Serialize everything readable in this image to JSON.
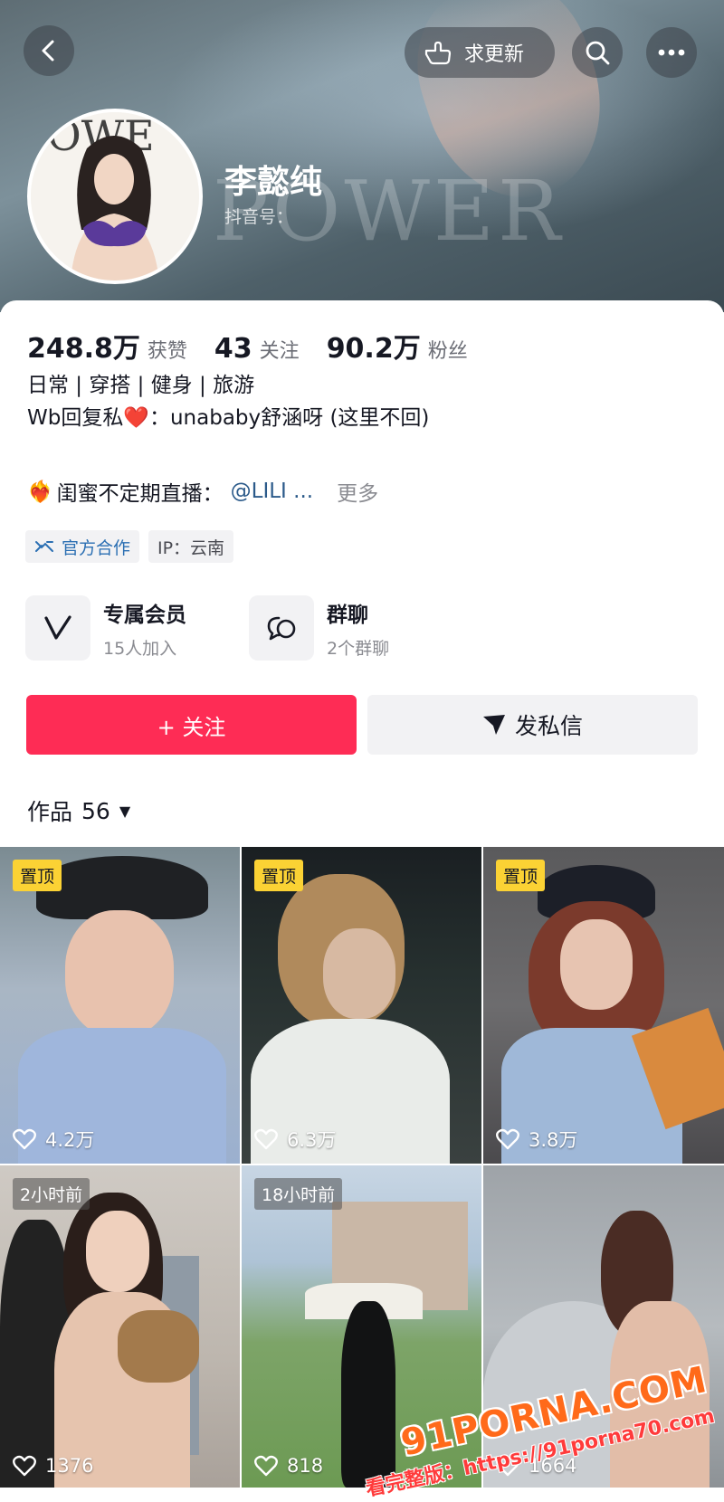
{
  "header": {
    "back_icon": "chevron-left-icon",
    "request_update_label": "求更新",
    "search_icon": "search-icon",
    "more_icon": "more-dots-icon",
    "banner_watermark": "POWER"
  },
  "profile": {
    "name": "李懿纯",
    "douyin_id_label": "抖音号：",
    "avatar_icon": "avatar-image"
  },
  "stats": [
    {
      "value": "248.8万",
      "label": "获赞"
    },
    {
      "value": "43",
      "label": "关注"
    },
    {
      "value": "90.2万",
      "label": "粉丝"
    }
  ],
  "bio": {
    "line1": "日常 | 穿搭 | 健身 | 旅游",
    "line2": "Wb回复私❤️：unababy舒涵呀 (这里不回)",
    "live_icon": "❤️‍🔥",
    "live_text": "闺蜜不定期直播：",
    "live_mention": "@LILI ...",
    "more": "更多"
  },
  "tags": {
    "official": "官方合作",
    "ip": "IP：云南"
  },
  "entries": {
    "membership": {
      "title": "专属会员",
      "subtitle": "15人加入"
    },
    "group_chat": {
      "title": "群聊",
      "subtitle": "2个群聊"
    }
  },
  "actions": {
    "follow": "+ 关注",
    "message": "发私信"
  },
  "works": {
    "label": "作品",
    "count": "56"
  },
  "videos": [
    {
      "badge": "置顶",
      "badge_type": "pinned",
      "likes": "4.2万"
    },
    {
      "badge": "置顶",
      "badge_type": "pinned",
      "likes": "6.3万"
    },
    {
      "badge": "置顶",
      "badge_type": "pinned",
      "likes": "3.8万"
    },
    {
      "badge": "2小时前",
      "badge_type": "time",
      "likes": "1376"
    },
    {
      "badge": "18小时前",
      "badge_type": "time",
      "likes": "818"
    },
    {
      "badge": "",
      "badge_type": "none",
      "likes": "1664"
    }
  ],
  "watermark": {
    "line1": "91PORNA.COM",
    "line2": "看完整版：https://91porna70.com"
  },
  "colors": {
    "accent": "#fe2c55",
    "pinned_badge": "#fbd234",
    "link": "#2b5a8a"
  }
}
